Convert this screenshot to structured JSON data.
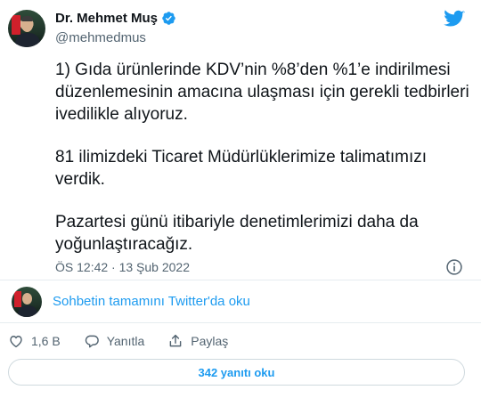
{
  "author": {
    "display_name": "Dr. Mehmet Muş",
    "handle": "@mehmedmus",
    "verified": true
  },
  "tweet": {
    "paragraphs": [
      "1) Gıda ürünlerinde KDV’nin %8’den %1’e indirilmesi düzenlemesinin amacına ulaşması için gerekli tedbirleri ivedilikle alıyoruz.",
      "81 ilimizdeki Ticaret Müdürlüklerimize talimatımızı verdik.",
      "Pazartesi günü itibariyle denetimlerimizi daha da yoğunlaştıracağız."
    ],
    "timestamp": "ÖS 12:42 · 13 Şub 2022"
  },
  "thread": {
    "link_label": "Sohbetin tamamını Twitter'da oku"
  },
  "actions": {
    "like_count": "1,6 B",
    "reply_label": "Yanıtla",
    "share_label": "Paylaş"
  },
  "replies_button": {
    "label": "342 yanıtı oku"
  },
  "colors": {
    "accent": "#1d9bf0",
    "text_primary": "#0f1419",
    "text_secondary": "#536471",
    "border": "#cfd9de"
  },
  "icons": [
    "verified-badge-icon",
    "twitter-bird-icon",
    "info-icon",
    "heart-icon",
    "reply-icon",
    "share-icon"
  ]
}
